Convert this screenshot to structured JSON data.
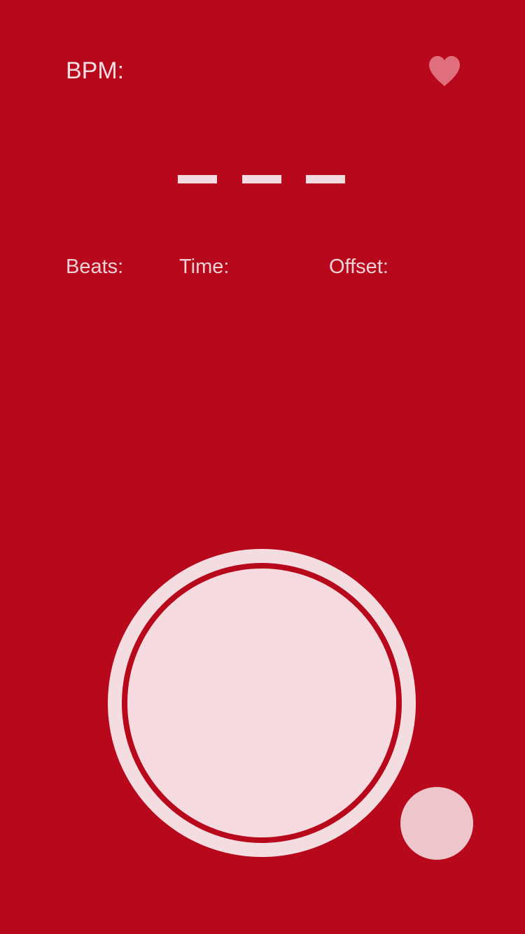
{
  "header": {
    "bpm_label": "BPM:",
    "favorite_icon": "heart-icon"
  },
  "display": {
    "bpm_value_placeholder": "— — —"
  },
  "stats": {
    "beats_label": "Beats:",
    "time_label": "Time:",
    "offset_label": "Offset:"
  },
  "controls": {
    "tap_icon": "circle-button",
    "reset_icon": "circle-button"
  },
  "colors": {
    "background": "#b8081b",
    "text": "#f4dde2",
    "tap_fill": "#f5dbdf",
    "reset_fill": "#ecc6cb",
    "heart_fill": "#df6f7d"
  }
}
